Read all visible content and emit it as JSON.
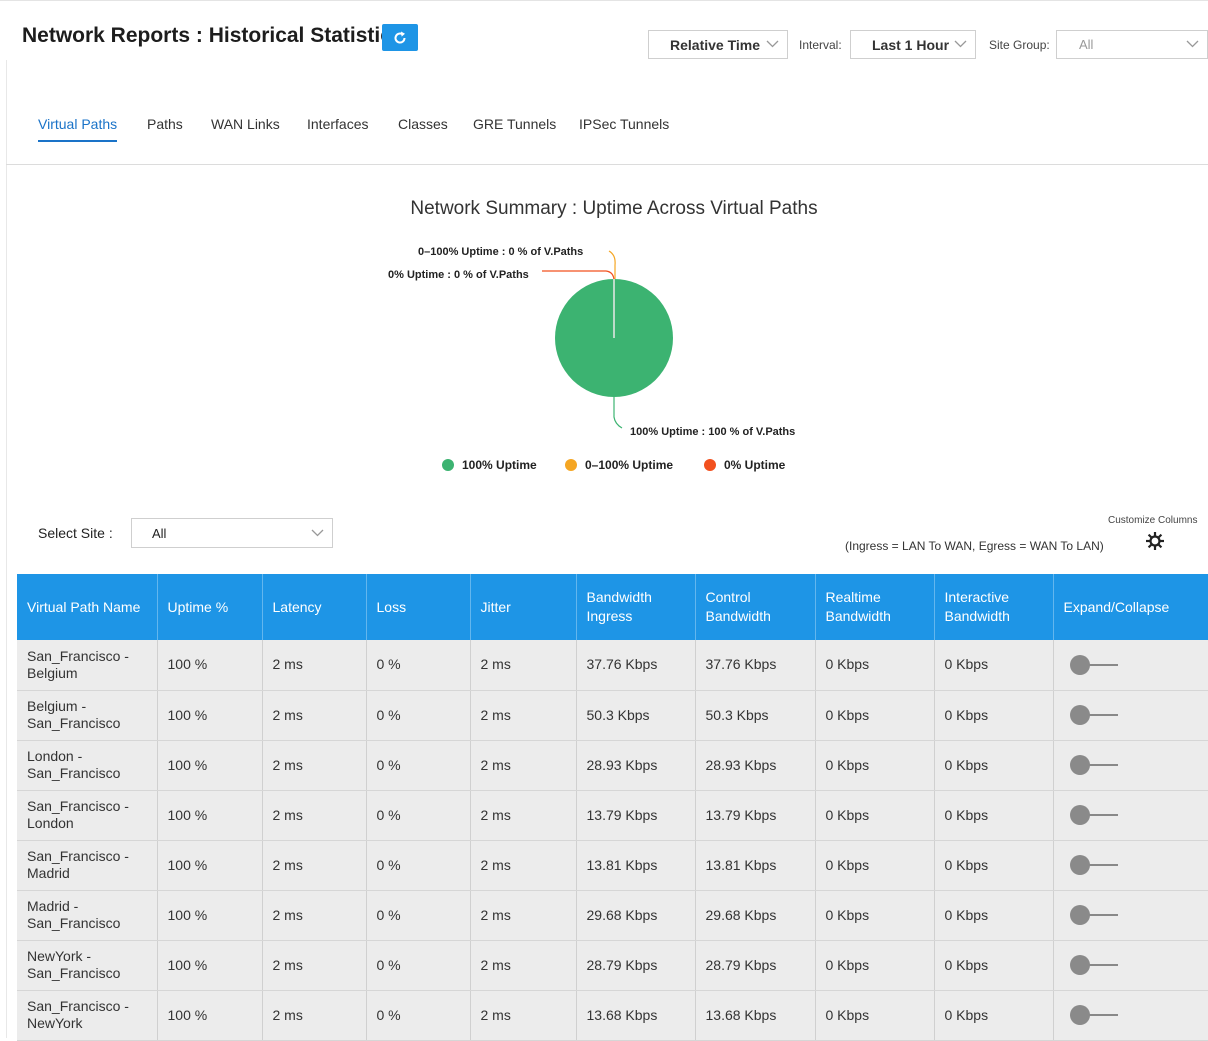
{
  "header": {
    "title": "Network Reports : Historical Statistics",
    "time_mode": "Relative Time",
    "interval_label": "Interval:",
    "interval_value": "Last 1 Hour",
    "site_group_label": "Site Group:",
    "site_group_value": "All"
  },
  "tabs": [
    {
      "label": "Virtual Paths",
      "active": true
    },
    {
      "label": "Paths"
    },
    {
      "label": "WAN Links"
    },
    {
      "label": "Interfaces"
    },
    {
      "label": "Classes"
    },
    {
      "label": "GRE Tunnels"
    },
    {
      "label": "IPSec Tunnels"
    }
  ],
  "chart_data": {
    "type": "pie",
    "title": "Network Summary : Uptime Across Virtual Paths",
    "categories": [
      "100% Uptime",
      "0–100% Uptime",
      "0% Uptime"
    ],
    "values": [
      100,
      0,
      0
    ],
    "colors": [
      "#3cb371",
      "#f5a623",
      "#f2501e"
    ],
    "data_labels": [
      "100% Uptime : 100 % of V.Paths",
      "0–100% Uptime : 0 % of V.Paths",
      "0% Uptime : 0 % of V.Paths"
    ],
    "legend_position": "bottom"
  },
  "filters": {
    "select_site_label": "Select Site :",
    "select_site_value": "All",
    "customize_label": "Customize Columns",
    "note": "(Ingress = LAN To WAN, Egress = WAN To LAN)"
  },
  "table": {
    "columns": [
      "Virtual Path Name",
      "Uptime %",
      "Latency",
      "Loss",
      "Jitter",
      "Bandwidth Ingress",
      "Control Bandwidth",
      "Realtime Bandwidth",
      "Interactive Bandwidth",
      "Expand/Collapse"
    ],
    "rows": [
      [
        "San_Francisco - Belgium",
        "100 %",
        "2 ms",
        "0 %",
        "2 ms",
        "37.76 Kbps",
        "37.76 Kbps",
        "0 Kbps",
        "0 Kbps"
      ],
      [
        "Belgium - San_Francisco",
        "100 %",
        "2 ms",
        "0 %",
        "2 ms",
        "50.3 Kbps",
        "50.3 Kbps",
        "0 Kbps",
        "0 Kbps"
      ],
      [
        "London - San_Francisco",
        "100 %",
        "2 ms",
        "0 %",
        "2 ms",
        "28.93 Kbps",
        "28.93 Kbps",
        "0 Kbps",
        "0 Kbps"
      ],
      [
        "San_Francisco - London",
        "100 %",
        "2 ms",
        "0 %",
        "2 ms",
        "13.79 Kbps",
        "13.79 Kbps",
        "0 Kbps",
        "0 Kbps"
      ],
      [
        "San_Francisco - Madrid",
        "100 %",
        "2 ms",
        "0 %",
        "2 ms",
        "13.81 Kbps",
        "13.81 Kbps",
        "0 Kbps",
        "0 Kbps"
      ],
      [
        "Madrid - San_Francisco",
        "100 %",
        "2 ms",
        "0 %",
        "2 ms",
        "29.68 Kbps",
        "29.68 Kbps",
        "0 Kbps",
        "0 Kbps"
      ],
      [
        "NewYork - San_Francisco",
        "100 %",
        "2 ms",
        "0 %",
        "2 ms",
        "28.79 Kbps",
        "28.79 Kbps",
        "0 Kbps",
        "0 Kbps"
      ],
      [
        "San_Francisco - NewYork",
        "100 %",
        "2 ms",
        "0 %",
        "2 ms",
        "13.68 Kbps",
        "13.68 Kbps",
        "0 Kbps",
        "0 Kbps"
      ]
    ]
  }
}
